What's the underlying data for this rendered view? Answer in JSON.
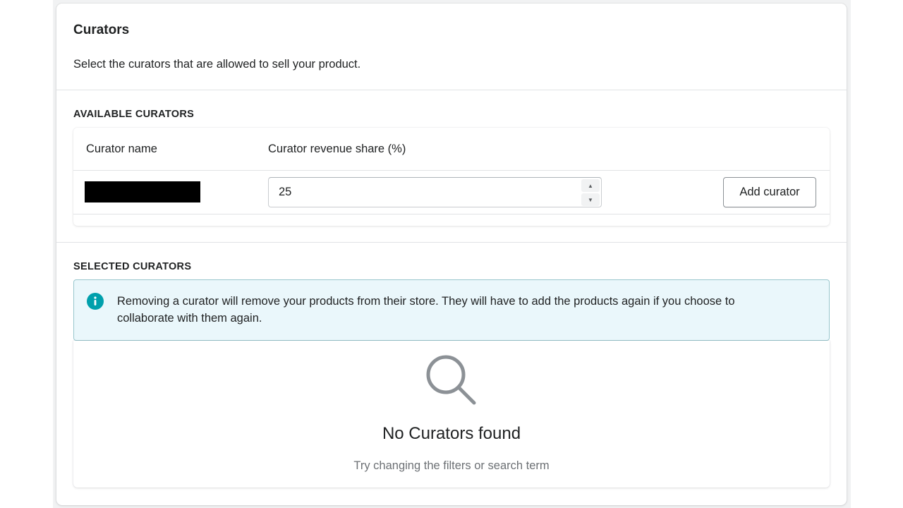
{
  "section": {
    "title": "Curators",
    "description": "Select the curators that are allowed to sell your product."
  },
  "available": {
    "label": "AVAILABLE CURATORS",
    "columns": [
      "Curator name",
      "Curator revenue share (%)"
    ],
    "rows": [
      {
        "name": "",
        "revenue_share": "25",
        "action_label": "Add curator"
      }
    ]
  },
  "selected": {
    "label": "SELECTED CURATORS",
    "banner_text": "Removing a curator will remove your products from their store. They will have to add the products again if you choose to collaborate with them again.",
    "empty_title": "No Curators found",
    "empty_subtitle": "Try changing the filters or search term"
  },
  "icons": {
    "banner": "info-icon",
    "empty_state": "search-icon",
    "stepper_up": "caret-up-icon",
    "stepper_down": "caret-down-icon"
  },
  "colors": {
    "info_accent": "#00a0ac",
    "banner_bg": "#eaf7fb",
    "banner_border": "#98c6cd",
    "empty_icon": "#8c9196"
  }
}
